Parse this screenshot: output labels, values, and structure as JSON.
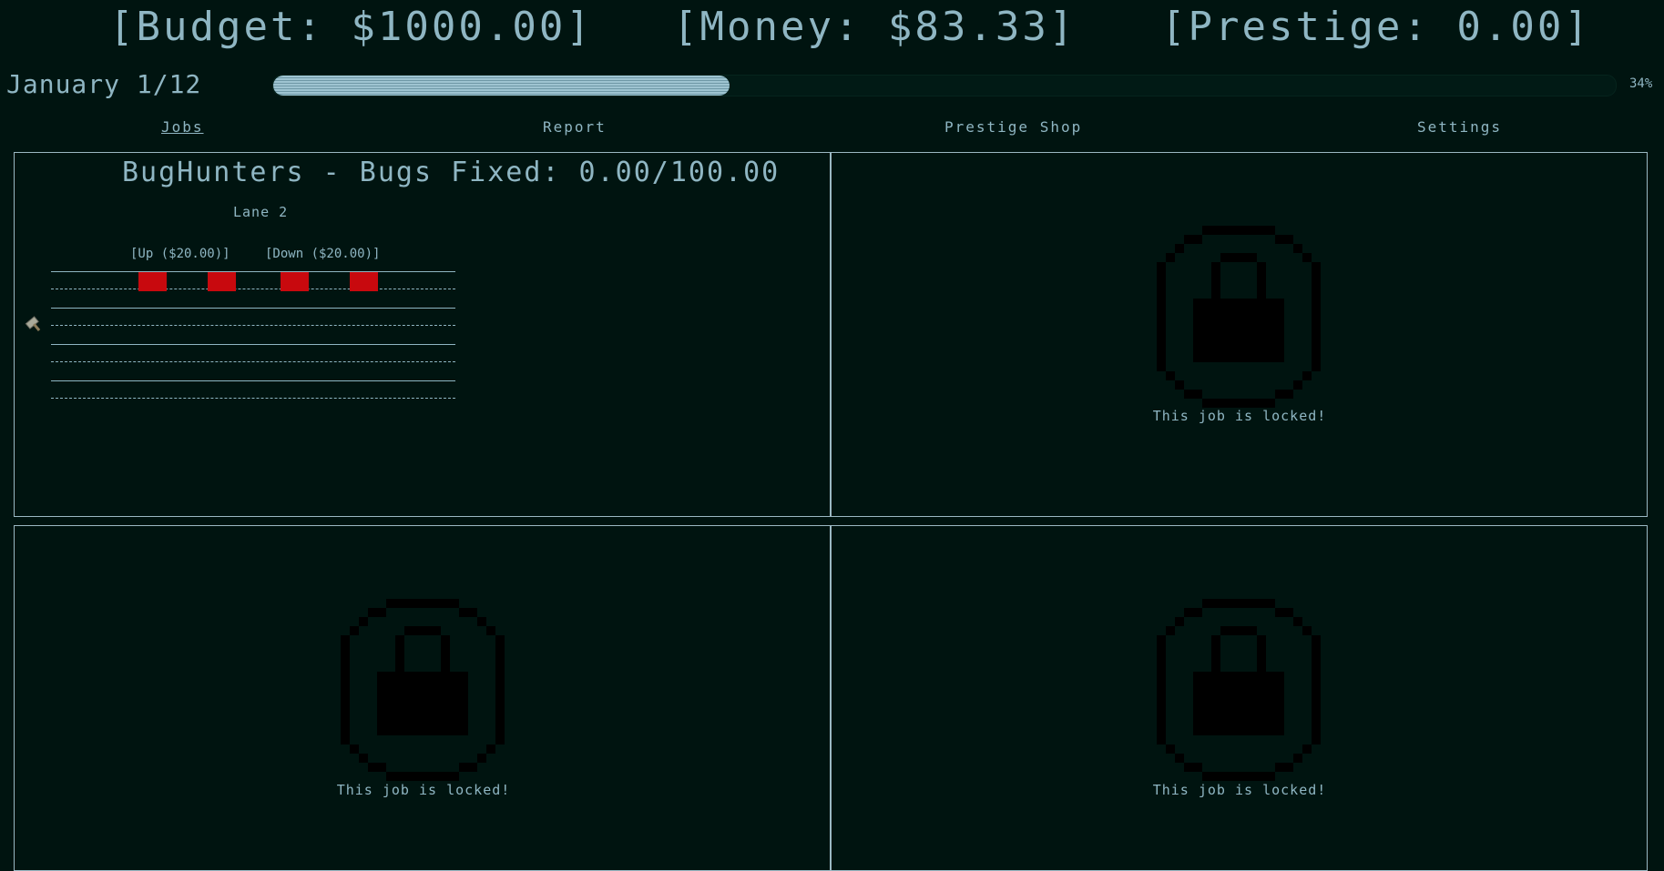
{
  "stats": {
    "budget": "[Budget: $1000.00]",
    "money": "[Money: $83.33]",
    "prestige": "[Prestige: 0.00]"
  },
  "month": {
    "label": "January 1/12",
    "progress_percent": 34,
    "progress_label": "34%"
  },
  "nav": {
    "jobs": "Jobs",
    "report": "Report",
    "prestige_shop": "Prestige Shop",
    "settings": "Settings",
    "active": "jobs"
  },
  "job1": {
    "title": "BugHunters - Bugs Fixed: 0.00/100.00",
    "lane_label": "Lane 2",
    "up_button": "[Up ($20.00)]",
    "down_button": "[Down ($20.00)]",
    "bug_count": 4,
    "hammer_icon": "hammer-icon"
  },
  "locked": {
    "text": "This job is locked!",
    "icon": "lock-icon"
  },
  "colors": {
    "background": "#001410",
    "text": "#8fb6c3",
    "bug": "#c8090e",
    "lock": "#000000"
  }
}
